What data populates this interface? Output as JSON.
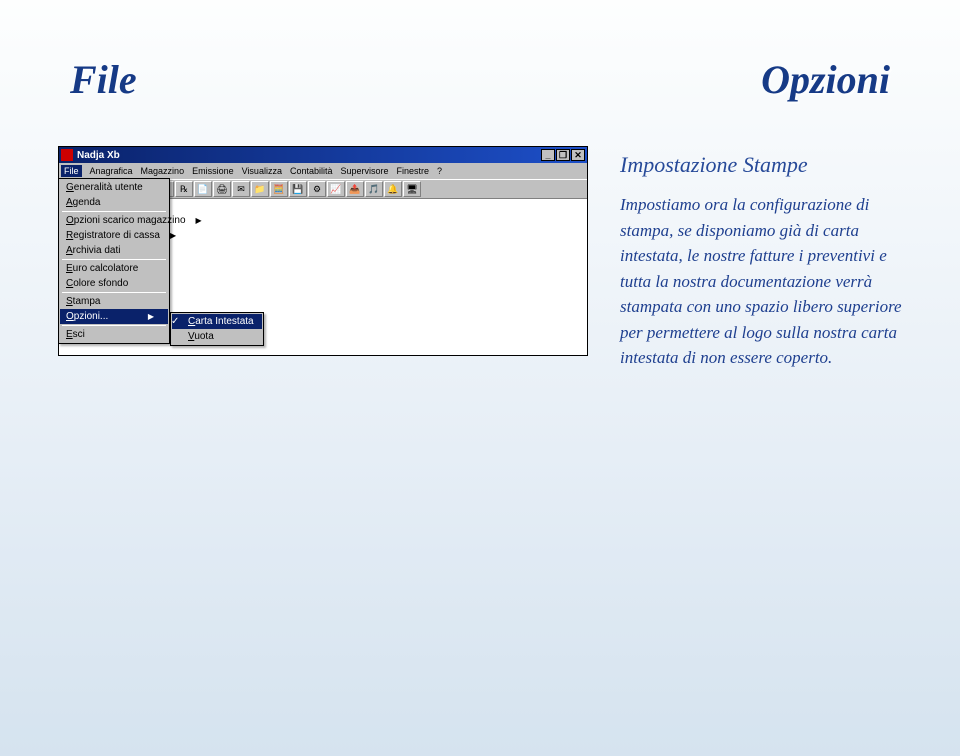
{
  "headings": {
    "file": "File",
    "opzioni": "Opzioni"
  },
  "info": {
    "title": "Impostazione Stampe",
    "body": "Impostiamo ora la configurazione di stampa, se disponiamo già di carta intestata, le nostre fatture i preventivi e tutta la nostra documentazione verrà stampata con uno spazio libero superiore per permettere al logo sulla nostra carta intestata di non essere coperto."
  },
  "app": {
    "title": "Nadja Xb",
    "winbtns": {
      "min": "_",
      "max": "❐",
      "close": "✕"
    },
    "menubar": [
      "File",
      "Anagrafica",
      "Magazzino",
      "Emissione",
      "Visualizza",
      "Contabilità",
      "Supervisore",
      "Finestre",
      "?"
    ]
  },
  "file_menu": {
    "items": [
      {
        "label": "Generalità utente",
        "arrow": false
      },
      {
        "label": "Agenda",
        "arrow": false,
        "sep_after": true
      },
      {
        "label": "Opzioni scarico magazzino",
        "arrow": true
      },
      {
        "label": "Registratore di cassa",
        "arrow": true
      },
      {
        "label": "Archivia dati",
        "arrow": false,
        "sep_after": true
      },
      {
        "label": "Euro calcolatore",
        "arrow": false
      },
      {
        "label": "Colore sfondo",
        "arrow": false,
        "sep_after": true
      },
      {
        "label": "Stampa",
        "arrow": false
      },
      {
        "label": "Opzioni...",
        "arrow": true,
        "highlight": true,
        "sep_after": true
      },
      {
        "label": "Esci",
        "arrow": false
      }
    ]
  },
  "opzioni_submenu": {
    "items": [
      {
        "label": "Carta Intestata",
        "checked": true,
        "highlight": true
      },
      {
        "label": "Vuota",
        "checked": false
      }
    ]
  }
}
